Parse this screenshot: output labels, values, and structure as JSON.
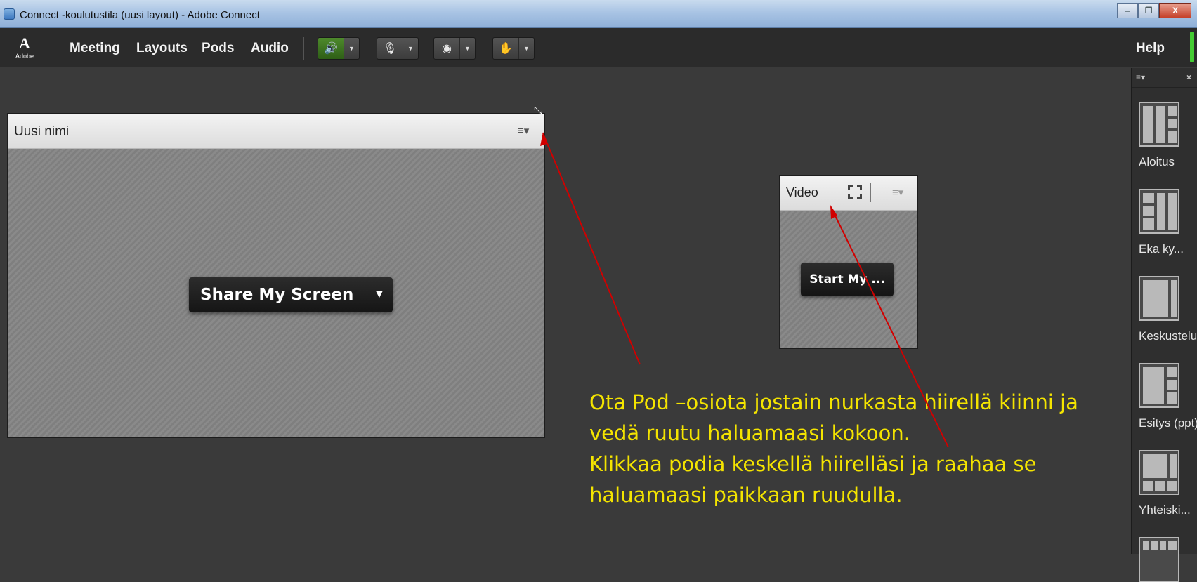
{
  "window": {
    "title": "Connect -koulutustila (uusi layout) - Adobe Connect",
    "minimize_label": "–",
    "restore_label": "❐",
    "close_label": "X"
  },
  "menubar": {
    "logo_mark": "A",
    "logo_word": "Adobe",
    "items": [
      {
        "label": "Meeting"
      },
      {
        "label": "Layouts"
      },
      {
        "label": "Pods"
      },
      {
        "label": "Audio"
      }
    ],
    "controls": [
      {
        "name": "speaker-icon",
        "glyph": "🔊"
      },
      {
        "name": "microphone-icon",
        "glyph": "🎙"
      },
      {
        "name": "webcam-icon",
        "glyph": "◉"
      },
      {
        "name": "raise-hand-icon",
        "glyph": "✋"
      }
    ],
    "dropdown_glyph": "▼",
    "help_label": "Help",
    "status_color": "#44cc33"
  },
  "share_pod": {
    "title": "Uusi nimi",
    "menu_glyph": "≡▾",
    "button_label": "Share My Screen",
    "button_arrow": "▼",
    "resize_glyph": "⤡"
  },
  "video_pod": {
    "title": "Video",
    "menu_glyph": "≡▾",
    "start_label": "Start My ..."
  },
  "instructions": {
    "line1": "Ota Pod –osiota jostain nurkasta hiirellä kiinni ja",
    "line2": "vedä ruutu haluamaasi kokoon.",
    "line3": "Klikkaa podia keskellä hiirelläsi ja raahaa se",
    "line4": "haluamaasi paikkaan ruudulla."
  },
  "layouts_panel": {
    "menu_glyph": "≡▾",
    "close_glyph": "×",
    "items": [
      {
        "label": "Aloitus"
      },
      {
        "label": "Eka ky..."
      },
      {
        "label": "Keskustelu"
      },
      {
        "label": "Esitys (ppt)"
      },
      {
        "label": "Yhteiski..."
      }
    ]
  },
  "colors": {
    "annotation_text": "#f4e400",
    "annotation_arrow": "#d10000",
    "background": "#3a3a3a",
    "menubar": "#2b2b2b"
  }
}
